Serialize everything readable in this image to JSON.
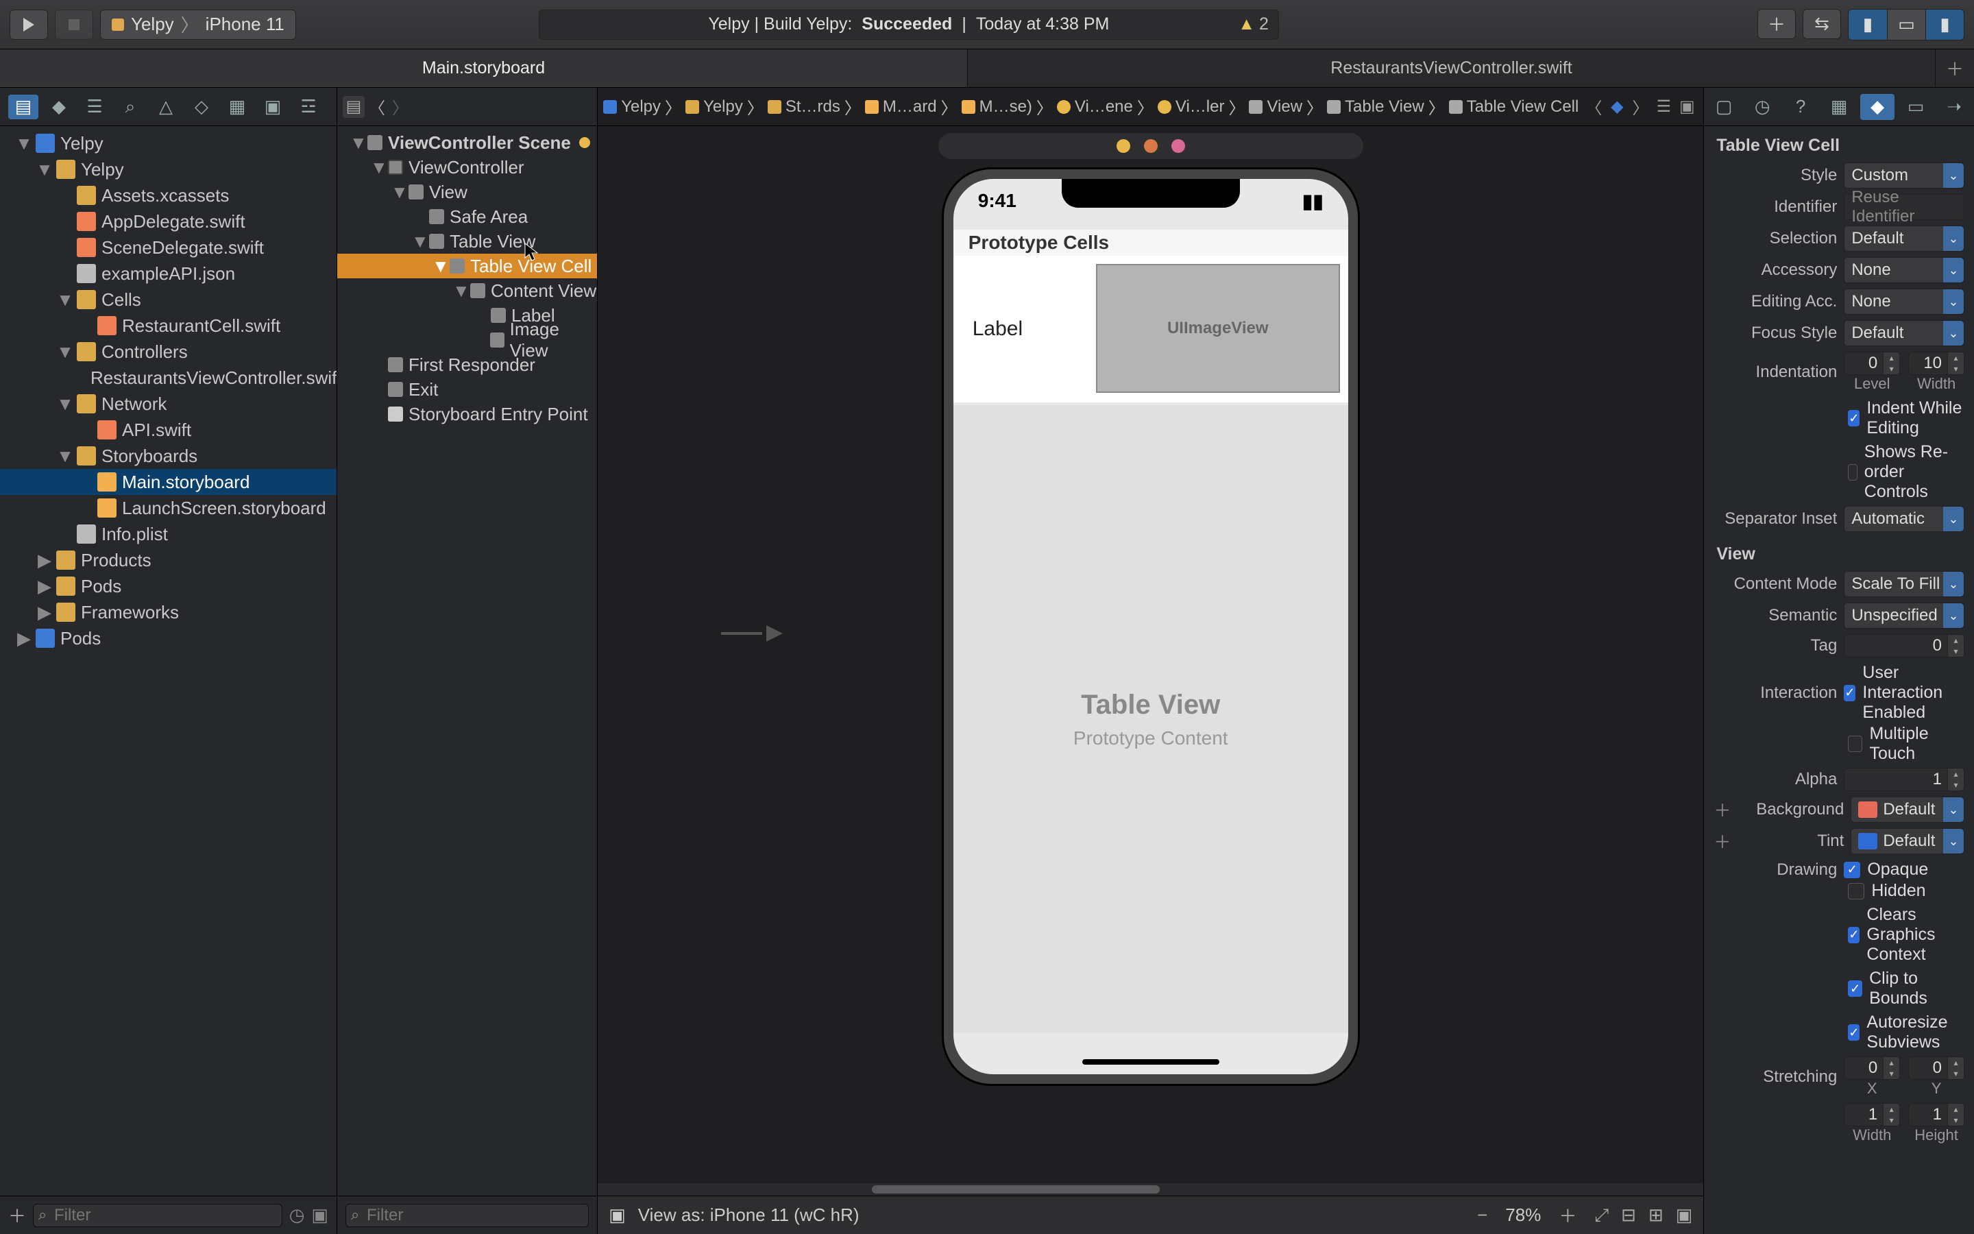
{
  "toolbar": {
    "scheme_app": "Yelpy",
    "scheme_device": "iPhone 11",
    "status_prefix": "Yelpy | Build Yelpy:",
    "status_result": "Succeeded",
    "status_time": "Today at 4:38 PM",
    "warning_count": "2"
  },
  "tabs": {
    "left": "Main.storyboard",
    "right": "RestaurantsViewController.swift"
  },
  "nav": {
    "filter_placeholder": "Filter",
    "root": "Yelpy",
    "app": "Yelpy",
    "items": [
      "Assets.xcassets",
      "AppDelegate.swift",
      "SceneDelegate.swift",
      "exampleAPI.json"
    ],
    "cells_group": "Cells",
    "cells": [
      "RestaurantCell.swift"
    ],
    "controllers_group": "Controllers",
    "controllers": [
      "RestaurantsViewController.swift"
    ],
    "network_group": "Network",
    "network": [
      "API.swift"
    ],
    "storyboards_group": "Storyboards",
    "storyboards": [
      "Main.storyboard",
      "LaunchScreen.storyboard"
    ],
    "info": "Info.plist",
    "products": "Products",
    "pods_group": "Pods",
    "frameworks": "Frameworks",
    "pods_proj": "Pods"
  },
  "outline": {
    "filter_placeholder": "Filter",
    "scene": "ViewController Scene",
    "vc": "ViewController",
    "view": "View",
    "safe_area": "Safe Area",
    "table_view": "Table View",
    "cell": "Table View Cell",
    "content_view": "Content View",
    "label": "Label",
    "image": "Image View",
    "first_responder": "First Responder",
    "exit": "Exit",
    "entry": "Storyboard Entry Point"
  },
  "jumpbar": {
    "crumbs": [
      "Yelpy",
      "Yelpy",
      "St…rds",
      "M…ard",
      "M…se)",
      "Vi…ene",
      "Vi…ler",
      "View",
      "Table View",
      "Table View Cell"
    ]
  },
  "device": {
    "time": "9:41",
    "proto_header": "Prototype Cells",
    "cell_label": "Label",
    "image_view": "UIImageView",
    "tv_title": "Table View",
    "tv_sub": "Prototype Content"
  },
  "canvasbar": {
    "view_as": "View as: iPhone 11 (wC hR)",
    "zoom": "78%"
  },
  "inspector": {
    "title": "Table View Cell",
    "style_lbl": "Style",
    "style_val": "Custom",
    "identifier_lbl": "Identifier",
    "identifier_ph": "Reuse Identifier",
    "selection_lbl": "Selection",
    "selection_val": "Default",
    "accessory_lbl": "Accessory",
    "accessory_val": "None",
    "editing_lbl": "Editing Acc.",
    "editing_val": "None",
    "focus_lbl": "Focus Style",
    "focus_val": "Default",
    "indent_lbl": "Indentation",
    "indent_level": "0",
    "indent_width": "10",
    "indent_level_sub": "Level",
    "indent_width_sub": "Width",
    "indent_while": "Indent While Editing",
    "reorder": "Shows Re-order Controls",
    "sep_lbl": "Separator Inset",
    "sep_val": "Automatic",
    "view_hdr": "View",
    "content_mode_lbl": "Content Mode",
    "content_mode_val": "Scale To Fill",
    "semantic_lbl": "Semantic",
    "semantic_val": "Unspecified",
    "tag_lbl": "Tag",
    "tag_val": "0",
    "interaction_lbl": "Interaction",
    "uie": "User Interaction Enabled",
    "mt": "Multiple Touch",
    "alpha_lbl": "Alpha",
    "alpha_val": "1",
    "bg_lbl": "Background",
    "bg_val": "Default",
    "tint_lbl": "Tint",
    "tint_val": "Default",
    "drawing_lbl": "Drawing",
    "opaque": "Opaque",
    "hidden": "Hidden",
    "clears": "Clears Graphics Context",
    "clip": "Clip to Bounds",
    "autoresize": "Autoresize Subviews",
    "stretching_lbl": "Stretching",
    "stretch_x": "0",
    "stretch_y": "0",
    "x_sub": "X",
    "y_sub": "Y",
    "stretch_w": "1",
    "stretch_h": "1",
    "w_sub": "Width",
    "h_sub": "Height"
  }
}
